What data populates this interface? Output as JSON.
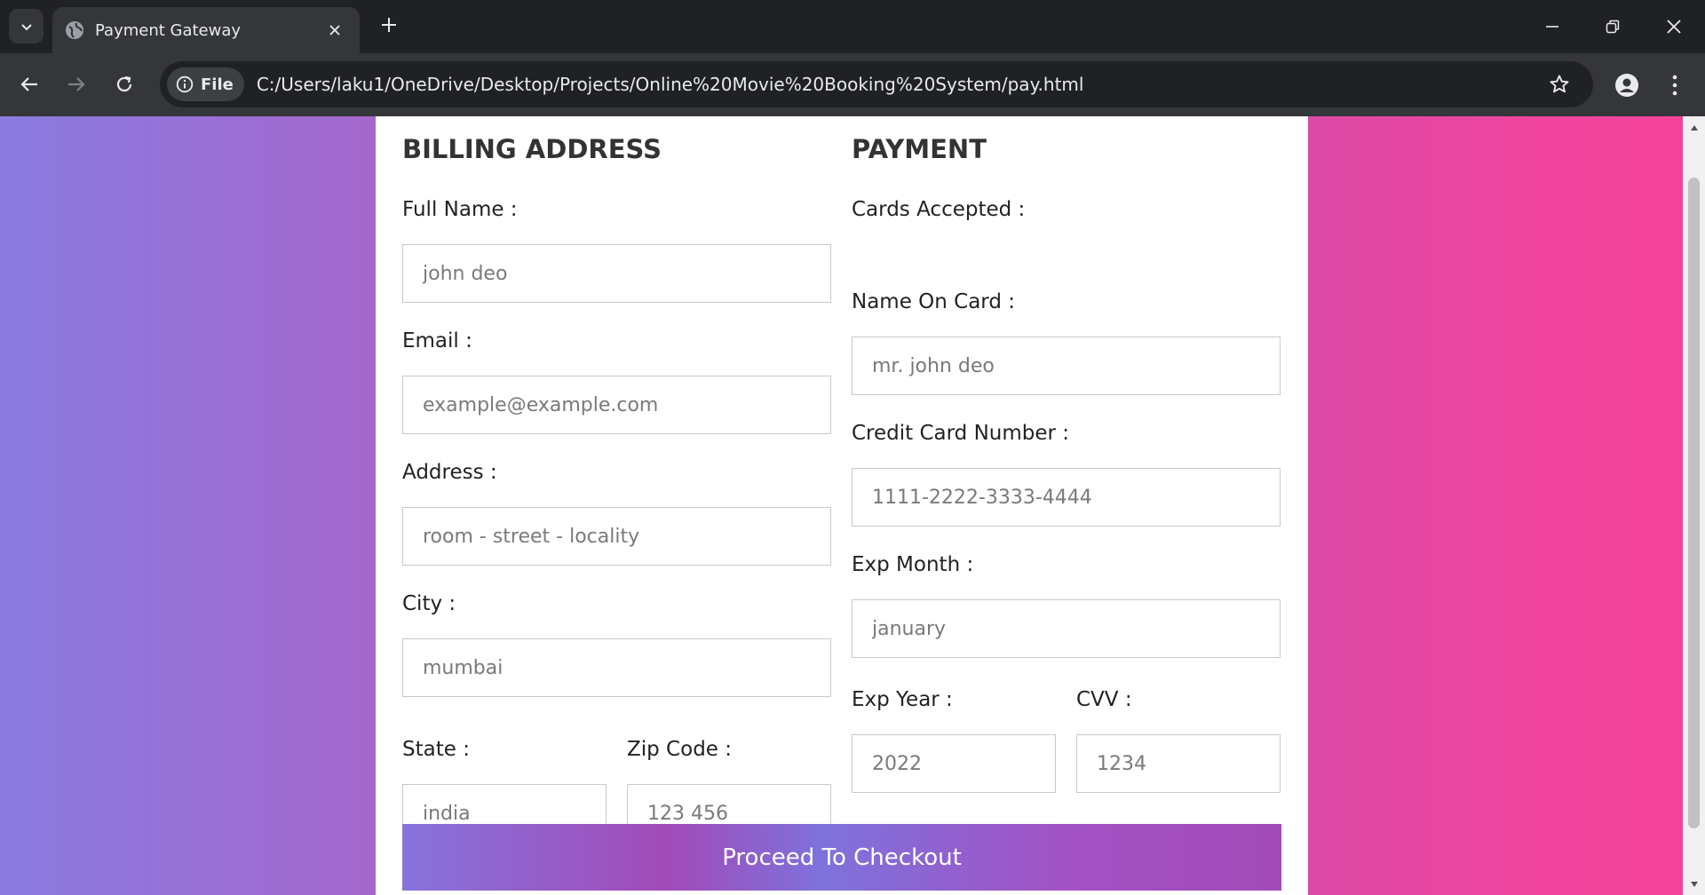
{
  "browser": {
    "tab_title": "Payment Gateway",
    "chip_label": "File",
    "url": "C:/Users/laku1/OneDrive/Desktop/Projects/Online%20Movie%20Booking%20System/pay.html",
    "icons": [
      "tab-list-icon",
      "globe-icon",
      "close-icon",
      "plus-icon",
      "minimize-icon",
      "restore-icon",
      "window-close-icon",
      "back-arrow-icon",
      "forward-arrow-icon",
      "reload-icon",
      "info-icon",
      "star-icon",
      "profile-icon",
      "kebab-menu-icon"
    ]
  },
  "billing": {
    "heading": "BILLING ADDRESS",
    "full_name": {
      "label": "Full Name :",
      "placeholder": "john deo"
    },
    "email": {
      "label": "Email :",
      "placeholder": "example@example.com"
    },
    "address": {
      "label": "Address :",
      "placeholder": "room - street - locality"
    },
    "city": {
      "label": "City :",
      "placeholder": "mumbai"
    },
    "state": {
      "label": "State :",
      "placeholder": "india"
    },
    "zip": {
      "label": "Zip Code :",
      "placeholder": "123 456"
    }
  },
  "payment": {
    "heading": "PAYMENT",
    "cards_accepted": "Cards Accepted :",
    "name_on_card": {
      "label": "Name On Card :",
      "placeholder": "mr. john deo"
    },
    "card_number": {
      "label": "Credit Card Number :",
      "placeholder": "1111-2222-3333-4444"
    },
    "exp_month": {
      "label": "Exp Month :",
      "placeholder": "january"
    },
    "exp_year": {
      "label": "Exp Year :",
      "placeholder": "2022"
    },
    "cvv": {
      "label": "CVV :",
      "placeholder": "1234"
    }
  },
  "checkout": {
    "label": "Proceed To Checkout"
  },
  "colors": {
    "gradient_left": "#8a7ce0",
    "gradient_right": "#f54297",
    "button_gradient_start": "#8674dc",
    "button_gradient_mid": "#a24ab8",
    "chrome_dark": "#202124",
    "chrome_toolbar": "#35363a"
  }
}
